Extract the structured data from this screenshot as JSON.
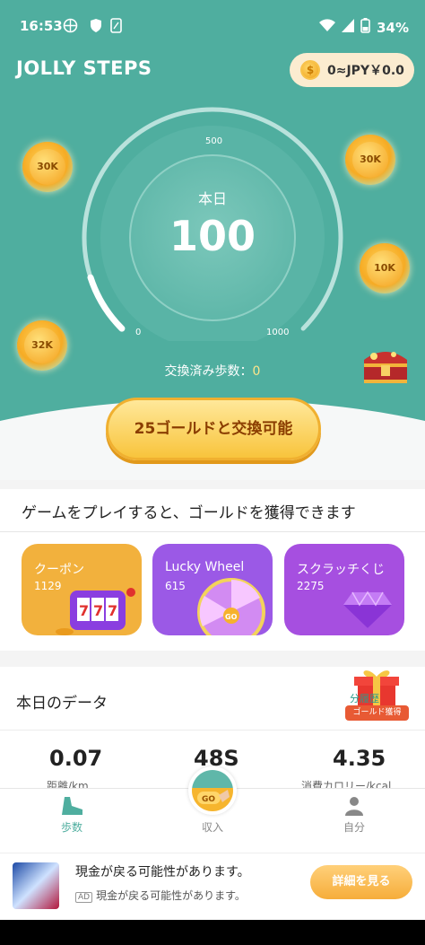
{
  "status_bar": {
    "time": "16:53",
    "battery": "34%"
  },
  "app": {
    "title": "JOLLY STEPS"
  },
  "wallet": {
    "text": "0≈JPY￥0.0",
    "coin_symbol": "$"
  },
  "bubbles": [
    {
      "label": "30K"
    },
    {
      "label": "30K"
    },
    {
      "label": "10K"
    },
    {
      "label": "32K"
    }
  ],
  "gauge": {
    "min_label": "0",
    "mid_label": "500",
    "max_label": "1000",
    "min": 0,
    "max": 1000,
    "value": 100
  },
  "today": {
    "label": "本日",
    "steps": "100"
  },
  "exchanged": {
    "label": "交換済み歩数：",
    "value": "0"
  },
  "exchange_button": {
    "label": "25ゴールドと交換可能"
  },
  "games": {
    "heading": "ゲームをプレイすると、ゴールドを獲得できます",
    "cards": [
      {
        "title": "クーポン",
        "count": "1129",
        "color": "#f2b13d"
      },
      {
        "title": "Lucky Wheel",
        "count": "615",
        "color": "#9b59e6"
      },
      {
        "title": "スクラッチくじ",
        "count": "2275",
        "color": "#a64fe0"
      }
    ]
  },
  "data_section": {
    "title": "本日のデータ",
    "gift_tag": "ゴールド獲得",
    "gift_text": "分履歴",
    "stats": [
      {
        "value": "0.07",
        "label": "距離/km"
      },
      {
        "value": "48S",
        "label": ""
      },
      {
        "value": "4.35",
        "label": "消費カロリー/kcal"
      }
    ]
  },
  "tabs": [
    {
      "label": "歩数",
      "icon": "shoe-icon",
      "active": true
    },
    {
      "label": "収入",
      "icon": "coin-icon",
      "active": false
    },
    {
      "label": "自分",
      "icon": "person-icon",
      "active": false
    }
  ],
  "ad": {
    "title": "現金が戻る可能性があります。",
    "badge": "AD",
    "subtitle": "現金が戻る可能性があります。",
    "button": "詳細を見る"
  },
  "colors": {
    "primary": "#4fae9f",
    "gold": "#f8c43c",
    "purple": "#9b59e6"
  }
}
